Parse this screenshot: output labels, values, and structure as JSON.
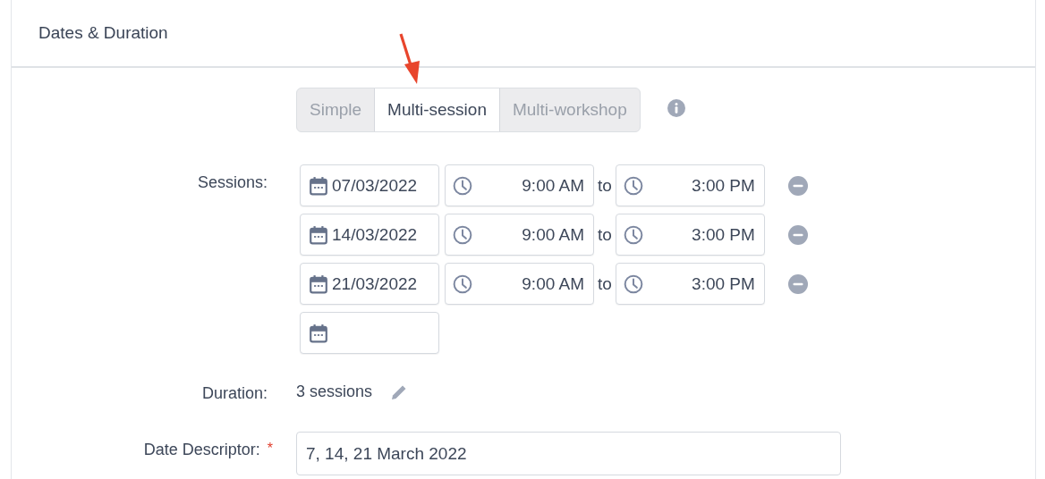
{
  "section": {
    "title": "Dates & Duration"
  },
  "mode_tabs": [
    {
      "label": "Simple",
      "selected": false
    },
    {
      "label": "Multi-session",
      "selected": true
    },
    {
      "label": "Multi-workshop",
      "selected": false
    }
  ],
  "sessions": {
    "label": "Sessions:",
    "rows": [
      {
        "date": "07/03/2022",
        "start": "9:00 AM",
        "separator": "to",
        "end": "3:00 PM"
      },
      {
        "date": "14/03/2022",
        "start": "9:00 AM",
        "separator": "to",
        "end": "3:00 PM"
      },
      {
        "date": "21/03/2022",
        "start": "9:00 AM",
        "separator": "to",
        "end": "3:00 PM"
      }
    ]
  },
  "duration": {
    "label": "Duration:",
    "value": "3 sessions"
  },
  "date_descriptor": {
    "label": "Date Descriptor:",
    "required_mark": "*",
    "value": "7, 14, 21 March 2022"
  }
}
